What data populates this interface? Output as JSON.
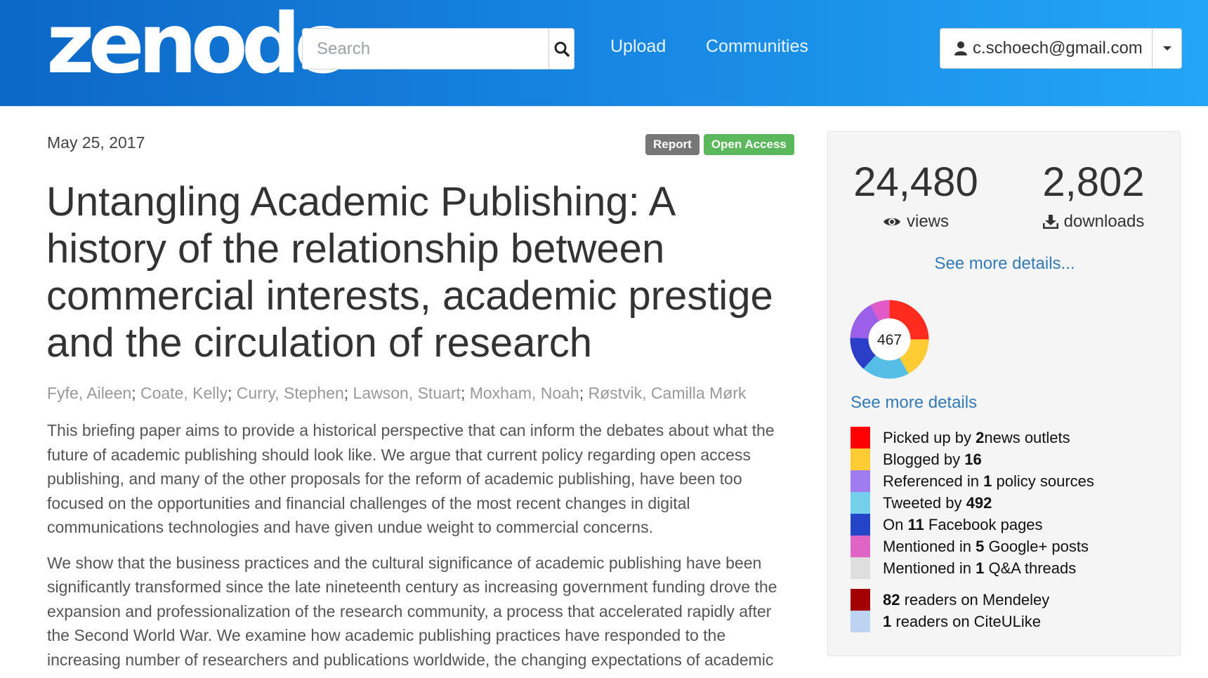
{
  "header": {
    "logo": "zenodo",
    "search": {
      "placeholder": "Search"
    },
    "nav": [
      "Upload",
      "Communities"
    ],
    "user": {
      "email": "c.schoech@gmail.com"
    }
  },
  "record": {
    "date": "May 25, 2017",
    "badges": [
      "Report",
      "Open Access"
    ],
    "title": "Untangling Academic Publishing: A history of the relationship between commercial interests, academic prestige and the circulation of research",
    "authors": [
      "Fyfe, Aileen",
      "Coate, Kelly",
      "Curry, Stephen",
      "Lawson, Stuart",
      "Moxham, Noah",
      "Røstvik, Camilla Mørk"
    ],
    "description": [
      "This briefing paper aims to provide a historical perspective that can inform the debates about what the future of academic publishing should look like. We argue that current policy regarding open access publishing, and many of the other proposals for the reform of academic publishing, have been too focused on the opportunities and financial challenges of the most recent changes in digital communications technologies and have given undue weight to commercial concerns.",
      "We show that the business practices and the cultural significance of academic publishing have been significantly transformed since the late nineteenth century as increasing government funding drove the expansion and professionalization of the research community, a process that accelerated rapidly after the Second World War. We examine how academic publishing practices have responded to the increasing number of researchers and publications worldwide, the changing expectations of academic"
    ]
  },
  "stats": {
    "views": {
      "value": "24,480",
      "label": "views"
    },
    "downloads": {
      "value": "2,802",
      "label": "downloads"
    },
    "see_more": "See more details..."
  },
  "altmetric": {
    "score": "467",
    "see_more": "See more details",
    "mentions": [
      {
        "color": "#ff0000",
        "prefix": "Picked up by ",
        "count": "2",
        "suffix": " news outlets"
      },
      {
        "color": "#ffcc33",
        "prefix": "Blogged by ",
        "count": "16",
        "suffix": ""
      },
      {
        "color": "#a07cf0",
        "prefix": "Referenced in ",
        "count": "1",
        "suffix": " policy sources"
      },
      {
        "color": "#74cfec",
        "prefix": "Tweeted by ",
        "count": "492",
        "suffix": ""
      },
      {
        "color": "#2445c8",
        "prefix": "On ",
        "count": "11",
        "suffix": " Facebook pages"
      },
      {
        "color": "#e063c6",
        "prefix": "Mentioned in ",
        "count": "5",
        "suffix": " Google+ posts"
      },
      {
        "color": "#dedede",
        "prefix": "Mentioned in ",
        "count": "1",
        "suffix": " Q&A threads"
      }
    ],
    "readers": [
      {
        "color": "#a30000",
        "prefix": "",
        "count": "82",
        "suffix": " readers on Mendeley"
      },
      {
        "color": "#bcd3f2",
        "prefix": "",
        "count": "1",
        "suffix": " readers on CiteULike"
      }
    ]
  },
  "icons": {
    "search": "search-icon",
    "user": "user-icon",
    "dropdown": "caret-down-icon",
    "views": "eye-icon",
    "downloads": "download-icon"
  }
}
